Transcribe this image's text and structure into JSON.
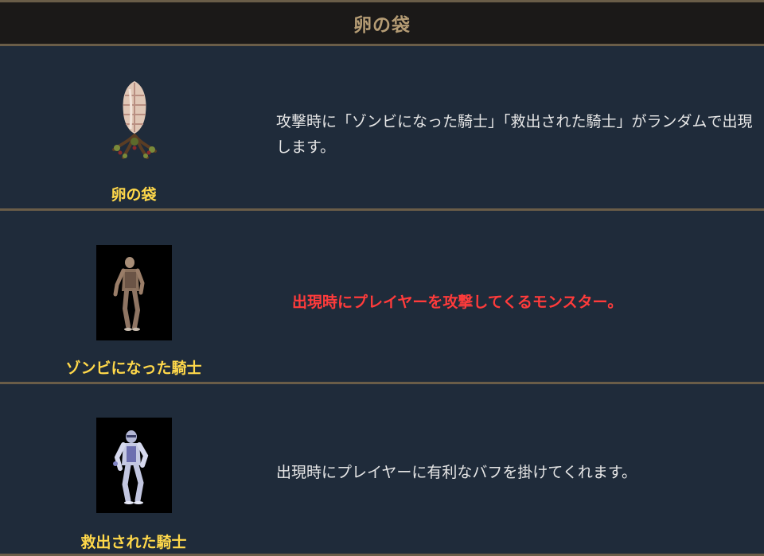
{
  "header": {
    "title": "卵の袋"
  },
  "rows": [
    {
      "caption": "卵の袋",
      "image_icon": "egg-sac-sprite-icon",
      "description": "攻撃時に「ゾンビになった騎士」「救出された騎士」がランダムで出現します。"
    },
    {
      "caption": "ゾンビになった騎士",
      "image_icon": "zombie-knight-sprite-icon",
      "description": "出現時にプレイヤーを攻撃してくるモンスター。"
    },
    {
      "caption": "救出された騎士",
      "image_icon": "rescued-knight-sprite-icon",
      "description": "出現時にプレイヤーに有利なバフを掛けてくれます。"
    }
  ],
  "colors": {
    "background": "#1e2a38",
    "header_bg": "#1b1918",
    "header_text": "#b59c74",
    "border": "#6a5d48",
    "caption": "#ffd84a",
    "description": "#e6e6e6",
    "warning": "#ff3b3b"
  }
}
